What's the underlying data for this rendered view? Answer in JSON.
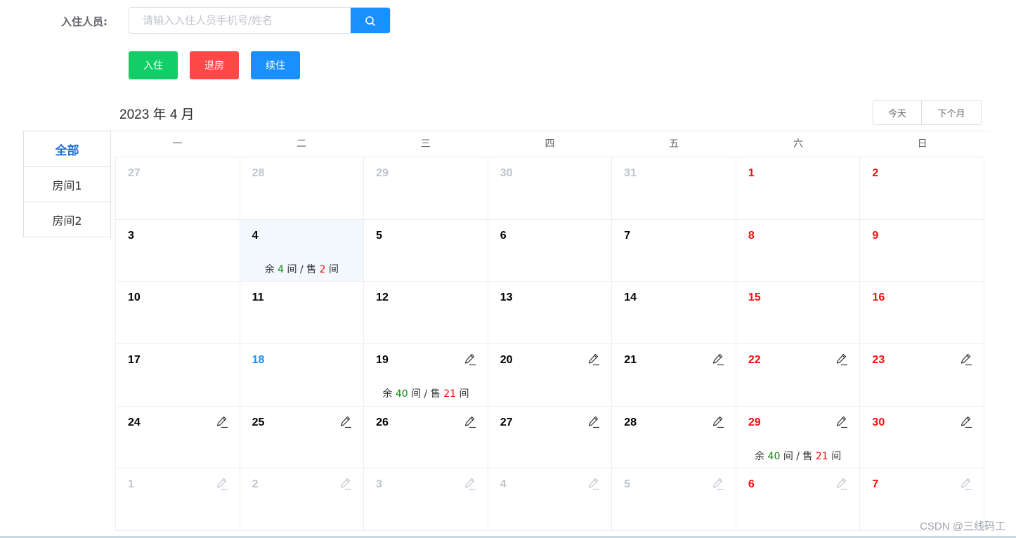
{
  "search": {
    "label": "入住人员:",
    "placeholder": "请输入入住人员手机号/姓名",
    "value": ""
  },
  "actions": {
    "checkin": "入住",
    "checkout": "退房",
    "renew": "续住"
  },
  "calendar": {
    "title": "2023 年 4 月",
    "today_label": "今天",
    "next_label": "下个月",
    "weekdays": [
      "一",
      "二",
      "三",
      "四",
      "五",
      "六",
      "日"
    ],
    "weeks": [
      [
        {
          "day": "27",
          "type": "other"
        },
        {
          "day": "28",
          "type": "other"
        },
        {
          "day": "29",
          "type": "other"
        },
        {
          "day": "30",
          "type": "other"
        },
        {
          "day": "31",
          "type": "other"
        },
        {
          "day": "1",
          "type": "weekend"
        },
        {
          "day": "2",
          "type": "weekend"
        }
      ],
      [
        {
          "day": "3",
          "type": "normal"
        },
        {
          "day": "4",
          "type": "normal",
          "selected": true,
          "stats": {
            "remain_prefix": "余",
            "remain": "4",
            "unit1": "间 / 售",
            "sold": "2",
            "unit2": "间"
          }
        },
        {
          "day": "5",
          "type": "normal"
        },
        {
          "day": "6",
          "type": "normal"
        },
        {
          "day": "7",
          "type": "normal"
        },
        {
          "day": "8",
          "type": "weekend"
        },
        {
          "day": "9",
          "type": "weekend"
        }
      ],
      [
        {
          "day": "10",
          "type": "normal"
        },
        {
          "day": "11",
          "type": "normal"
        },
        {
          "day": "12",
          "type": "normal"
        },
        {
          "day": "13",
          "type": "normal"
        },
        {
          "day": "14",
          "type": "normal"
        },
        {
          "day": "15",
          "type": "weekend"
        },
        {
          "day": "16",
          "type": "weekend"
        }
      ],
      [
        {
          "day": "17",
          "type": "normal"
        },
        {
          "day": "18",
          "type": "today"
        },
        {
          "day": "19",
          "type": "normal",
          "edit": true,
          "stats": {
            "remain_prefix": "余",
            "remain": "40",
            "unit1": "间 / 售",
            "sold": "21",
            "unit2": "间"
          }
        },
        {
          "day": "20",
          "type": "normal",
          "edit": true
        },
        {
          "day": "21",
          "type": "normal",
          "edit": true
        },
        {
          "day": "22",
          "type": "weekend",
          "edit": true
        },
        {
          "day": "23",
          "type": "weekend",
          "edit": true
        }
      ],
      [
        {
          "day": "24",
          "type": "normal",
          "edit": true
        },
        {
          "day": "25",
          "type": "normal",
          "edit": true
        },
        {
          "day": "26",
          "type": "normal",
          "edit": true
        },
        {
          "day": "27",
          "type": "normal",
          "edit": true
        },
        {
          "day": "28",
          "type": "normal",
          "edit": true
        },
        {
          "day": "29",
          "type": "weekend",
          "edit": true,
          "stats": {
            "remain_prefix": "余",
            "remain": "40",
            "unit1": "间 / 售",
            "sold": "21",
            "unit2": "间"
          }
        },
        {
          "day": "30",
          "type": "weekend",
          "edit": true
        }
      ],
      [
        {
          "day": "1",
          "type": "other",
          "edit": true
        },
        {
          "day": "2",
          "type": "other",
          "edit": true
        },
        {
          "day": "3",
          "type": "other",
          "edit": true
        },
        {
          "day": "4",
          "type": "other",
          "edit": true
        },
        {
          "day": "5",
          "type": "other",
          "edit": true
        },
        {
          "day": "6",
          "type": "weekend",
          "edit": true,
          "faded_icon": true
        },
        {
          "day": "7",
          "type": "weekend",
          "edit": true,
          "faded_icon": true
        }
      ]
    ]
  },
  "rooms": [
    {
      "label": "全部",
      "active": true
    },
    {
      "label": "房间1",
      "active": false
    },
    {
      "label": "房间2",
      "active": false
    }
  ],
  "colors": {
    "primary": "#1890ff",
    "success": "#13ce66",
    "danger": "#ff4949",
    "weekend_text": "#f50d0d",
    "remain_text": "#10870f",
    "selected_bg": "#f2f8fe"
  },
  "watermark": "CSDN @三线码工"
}
